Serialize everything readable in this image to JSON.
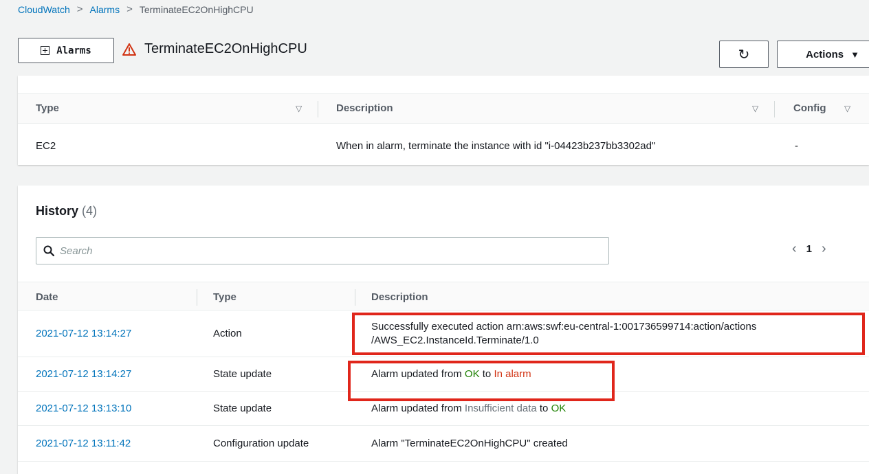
{
  "breadcrumb": {
    "items": [
      "CloudWatch",
      "Alarms"
    ],
    "current": "TerminateEC2OnHighCPU"
  },
  "header": {
    "alarms_button_label": "Alarms",
    "title": "TerminateEC2OnHighCPU",
    "actions_label": "Actions"
  },
  "actions_table": {
    "columns": [
      "Type",
      "Description",
      "Config"
    ],
    "rows": [
      {
        "type": "EC2",
        "description": "When in alarm, terminate the instance with id \"i-04423b237bb3302ad\"",
        "config": "-"
      }
    ]
  },
  "history": {
    "title": "History",
    "count": "(4)",
    "search_placeholder": "Search",
    "page": "1",
    "columns": [
      "Date",
      "Type",
      "Description"
    ],
    "rows": [
      {
        "date": "2021-07-12 13:14:27",
        "type": "Action",
        "description_line1": "Successfully executed action arn:aws:swf:eu-central-1:001736599714:action/actions",
        "description_line2": "/AWS_EC2.InstanceId.Terminate/1.0"
      },
      {
        "date": "2021-07-12 13:14:27",
        "type": "State update",
        "desc_prefix": "Alarm updated from",
        "from_state": "OK",
        "desc_mid": "to",
        "to_state": "In alarm"
      },
      {
        "date": "2021-07-12 13:13:10",
        "type": "State update",
        "desc_prefix": "Alarm updated from",
        "from_state": "Insufficient data",
        "desc_mid": "to",
        "to_state": "OK"
      },
      {
        "date": "2021-07-12 13:11:42",
        "type": "Configuration update",
        "description": "Alarm \"TerminateEC2OnHighCPU\" created"
      }
    ]
  },
  "colors": {
    "link": "#0073bb",
    "ok": "#1d8102",
    "in_alarm": "#d13212",
    "highlight": "#e0261b"
  }
}
